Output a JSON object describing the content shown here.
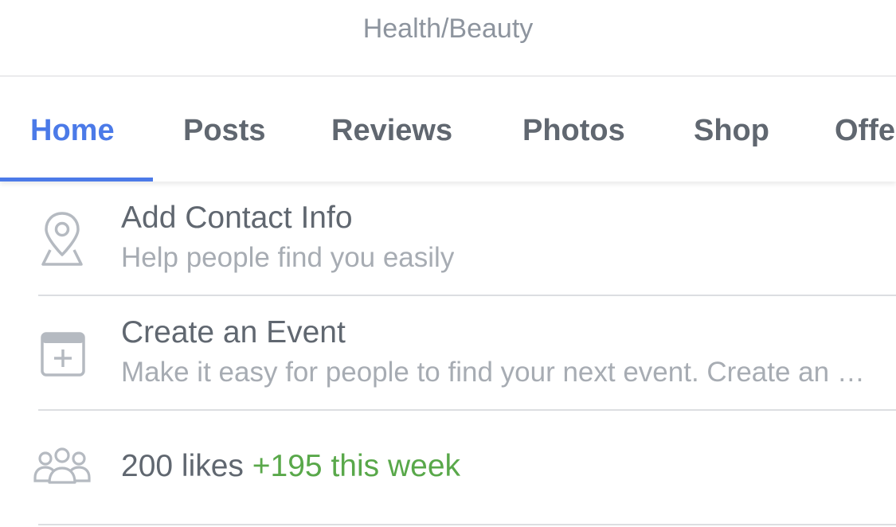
{
  "header": {
    "category": "Health/Beauty"
  },
  "tabs": [
    {
      "label": "Home",
      "active": true
    },
    {
      "label": "Posts",
      "active": false
    },
    {
      "label": "Reviews",
      "active": false
    },
    {
      "label": "Photos",
      "active": false
    },
    {
      "label": "Shop",
      "active": false
    },
    {
      "label": "Offers",
      "active": false
    }
  ],
  "rows": {
    "contact": {
      "icon": "location-pin-icon",
      "title": "Add Contact Info",
      "subtitle": "Help people find you easily"
    },
    "event": {
      "icon": "calendar-add-icon",
      "title": "Create an Event",
      "subtitle": "Make it easy for people to find your next event. Create an event to let people know what's happening"
    },
    "likes": {
      "icon": "people-group-icon",
      "count_text": "200 likes",
      "delta_text": "+195 this week"
    }
  },
  "colors": {
    "accent": "#4b7ae8",
    "tab_text": "#606770",
    "muted": "#a7acb3",
    "positive": "#59a84a"
  }
}
